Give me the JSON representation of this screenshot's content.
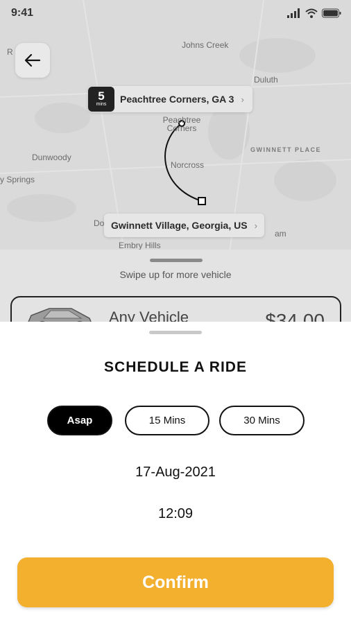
{
  "status_bar": {
    "time": "9:41"
  },
  "map": {
    "labels": {
      "johns_creek": "Johns Creek",
      "duluth": "Duluth",
      "peachtree_corners": "Peachtree Corners",
      "gwinnett_place": "GWINNETT PLACE",
      "dunwoody": "Dunwoody",
      "norcross": "Norcross",
      "sandy_springs": "y Springs",
      "embry_hills": "Embry Hills",
      "do": "Do",
      "am": "am",
      "r": "R"
    },
    "eta": {
      "value": "5",
      "unit": "mins"
    },
    "origin": "Peachtree Corners, GA 3",
    "destination": "Gwinnett Village, Georgia, US"
  },
  "vehicle_sheet": {
    "swipe_hint": "Swipe up for more vehicle",
    "vehicle_name": "Any Vehicle",
    "vehicle_price": "$34.00"
  },
  "schedule": {
    "title": "SCHEDULE A RIDE",
    "options": [
      {
        "label": "Asap",
        "active": true
      },
      {
        "label": "15 Mins",
        "active": false
      },
      {
        "label": "30 Mins",
        "active": false
      }
    ],
    "date": "17-Aug-2021",
    "time": "12:09",
    "confirm_label": "Confirm"
  },
  "colors": {
    "accent": "#f3b02f",
    "active_pill": "#000000",
    "map_bg": "#dadada"
  }
}
